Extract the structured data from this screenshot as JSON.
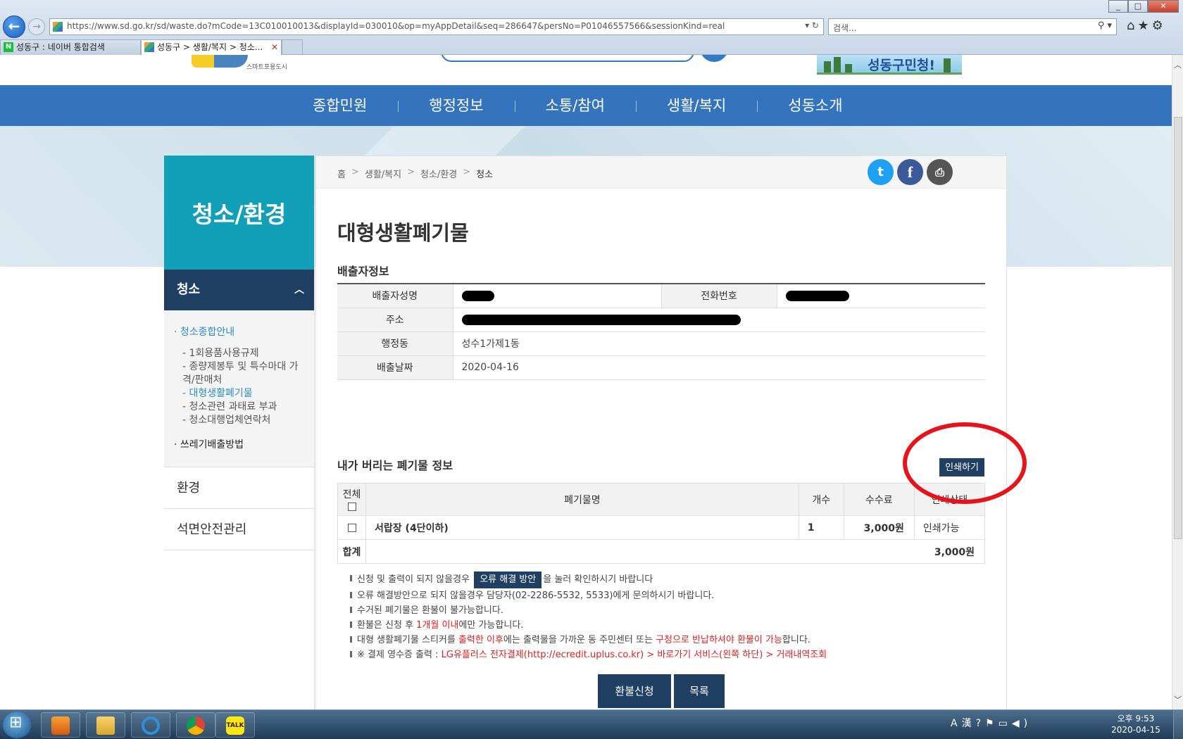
{
  "browser": {
    "url": "https://www.sd.go.kr/sd/waste.do?mCode=13C010010013&displayId=030010&op=myAppDetail&seq=286647&persNo=P01046557566&sessionKind=real",
    "search_placeholder": "검색...",
    "tabs": [
      {
        "label": "성동구 : 네이버 통합검색"
      },
      {
        "label": "성동구 > 생활/복지 > 청소..."
      }
    ]
  },
  "site": {
    "logo_sub": "스마트포용도시",
    "banner": "성동구민청!",
    "gnb": [
      "종합민원",
      "행정정보",
      "소통/참여",
      "생활/복지",
      "성동소개"
    ]
  },
  "sidebar": {
    "title": "청소/환경",
    "section": "청소",
    "group1": "청소종합안내",
    "items": [
      "1회용품사용규제",
      "종량제봉투 및 특수마대 가격/판매처",
      "대형생활폐기물",
      "청소관련 과태료 부과",
      "청소대행업체연락처"
    ],
    "group2": "쓰레기배출방법",
    "menu": [
      "환경",
      "석면안전관리"
    ]
  },
  "breadcrumb": [
    "홈",
    "생활/복지",
    "청소/환경",
    "청소"
  ],
  "page": {
    "title": "대형생활폐기물",
    "discharger_heading": "배출자정보",
    "labels": {
      "name": "배출자성명",
      "phone": "전화번호",
      "address": "주소",
      "dong": "행정동",
      "date": "배출날짜"
    },
    "values": {
      "dong": "성수1가제1동",
      "date": "2020-04-16"
    },
    "waste_heading": "내가 버리는 폐기물 정보",
    "print_button": "인쇄하기",
    "table": {
      "headers": [
        "전체",
        "폐기물명",
        "개수",
        "수수료",
        "인쇄상태"
      ],
      "rows": [
        {
          "name": "서랍장 (4단이하)",
          "count": "1",
          "fee": "3,000원",
          "status": "인쇄가능"
        }
      ],
      "total_label": "합계",
      "total_value": "3,000원"
    },
    "notes": {
      "n1_pre": "신청 및 출력이 되지 않을경우",
      "n1_btn": "오류 해결 방안",
      "n1_post": "을 눌러 확인하시기 바랍니다",
      "n2": "오류 해결방안으로 되지 않을경우 담당자(02-2286-5532, 5533)에게 문의하시기 바랍니다.",
      "n3": "수거된 폐기물은 환불이 불가능합니다.",
      "n4_a": "환불은 신청 후 ",
      "n4_b": "1개월 이내",
      "n4_c": "에만 가능합니다.",
      "n5_a": "대형 생활폐기물 스티커를 ",
      "n5_b": "출력한 이후",
      "n5_c": "에는 출력물을 가까운 동 주민센터 또는 ",
      "n5_d": "구청으로 반납하셔야 환불이 가능",
      "n5_e": "합니다.",
      "n6_a": "※ 결제 영수증 출력 : ",
      "n6_b": "LG유플러스 전자결제(http://ecredit.uplus.co.kr) > 바로가기 서비스(왼쪽 하단) > 거래내역조회"
    },
    "buttons": {
      "refund": "환불신청",
      "list": "목록"
    }
  },
  "taskbar": {
    "time": "오후 9:53",
    "date": "2020-04-15"
  }
}
